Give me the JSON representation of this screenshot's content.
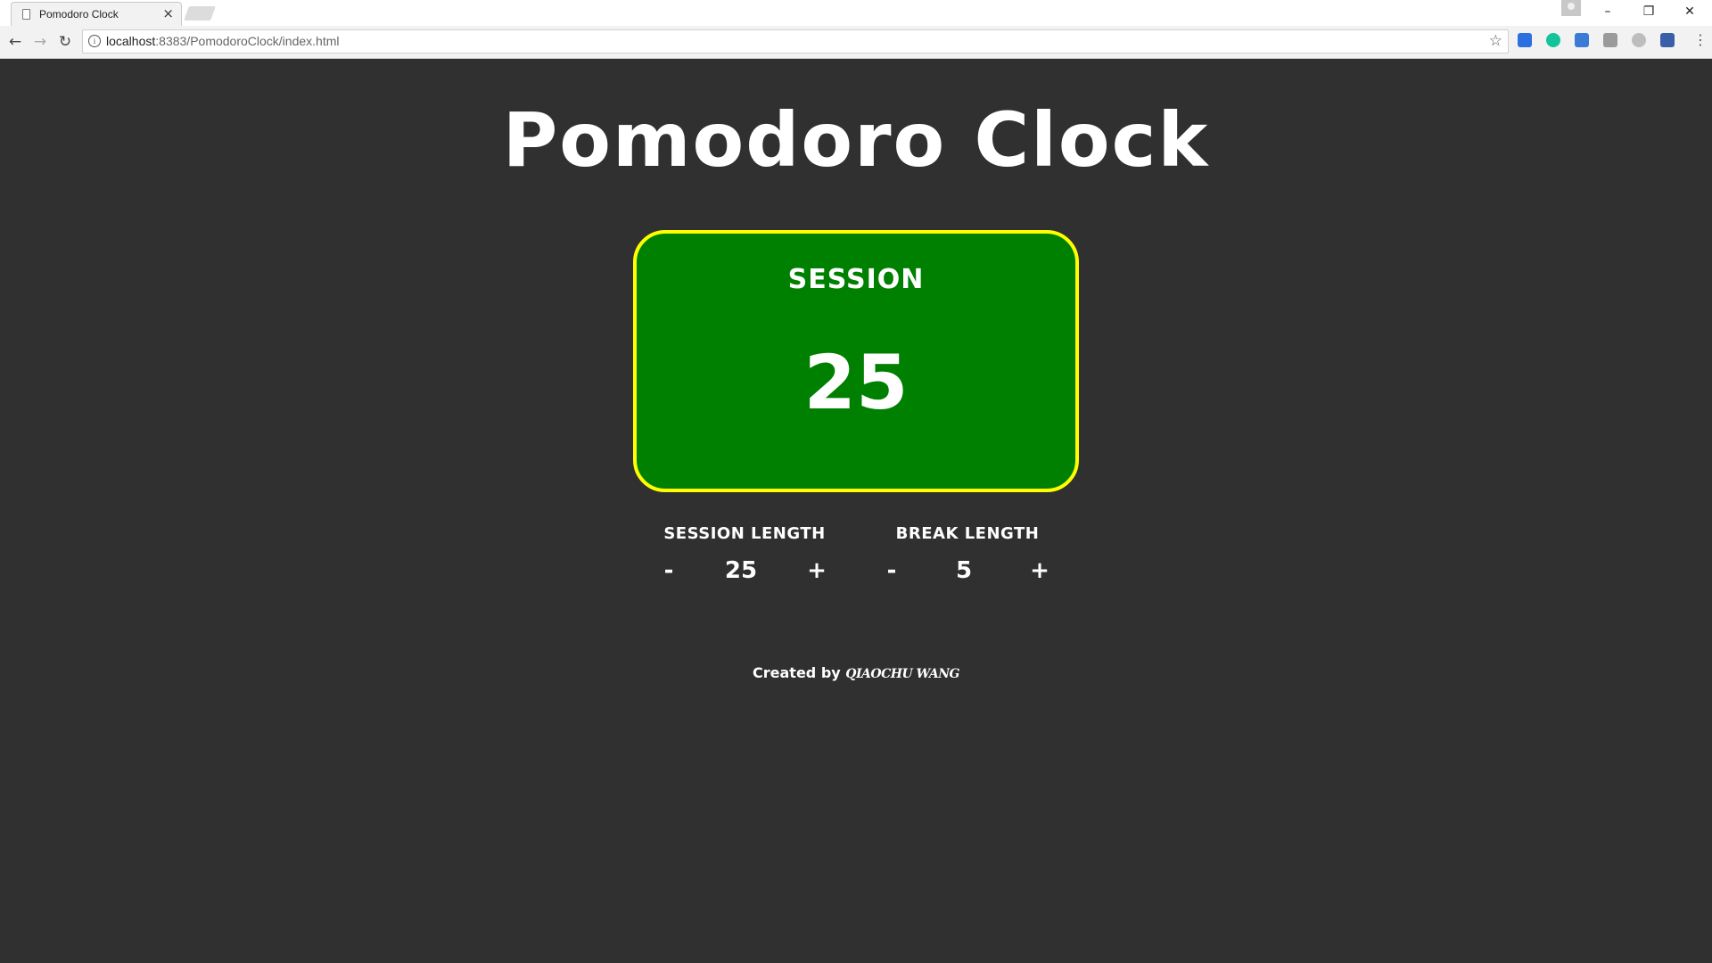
{
  "browser": {
    "tab_title": "Pomodoro Clock",
    "tab_close": "×",
    "url_host": "localhost",
    "url_rest": ":8383/PomodoroClock/index.html",
    "window_controls": {
      "minimize": "–",
      "restore": "❐",
      "close": "✕"
    },
    "nav": {
      "back": "←",
      "forward": "→",
      "reload": "↻"
    },
    "star": "☆",
    "menu": "⋮",
    "extensions": [
      {
        "name": "bookmark-ext-icon",
        "color": "#2b6fe0"
      },
      {
        "name": "grammarly-icon",
        "color": "#15c39a"
      },
      {
        "name": "extension-off-icon",
        "color": "#3a7bd5"
      },
      {
        "name": "page-ext-icon",
        "color": "#9a9a9a"
      },
      {
        "name": "gray-circle-ext-icon",
        "color": "#bdbdbd"
      },
      {
        "name": "cube-ext-icon",
        "color": "#3b5ea8"
      }
    ]
  },
  "page": {
    "title": "Pomodoro Clock"
  },
  "clock": {
    "label": "SESSION",
    "time": "25",
    "background": "#008000",
    "border": "#ffff00"
  },
  "session": {
    "label": "SESSION LENGTH",
    "decrement": "-",
    "value": "25",
    "increment": "+"
  },
  "break": {
    "label": "BREAK LENGTH",
    "decrement": "-",
    "value": "5",
    "increment": "+"
  },
  "footer": {
    "prefix": "Created by ",
    "author": "QIAOCHU WANG"
  }
}
